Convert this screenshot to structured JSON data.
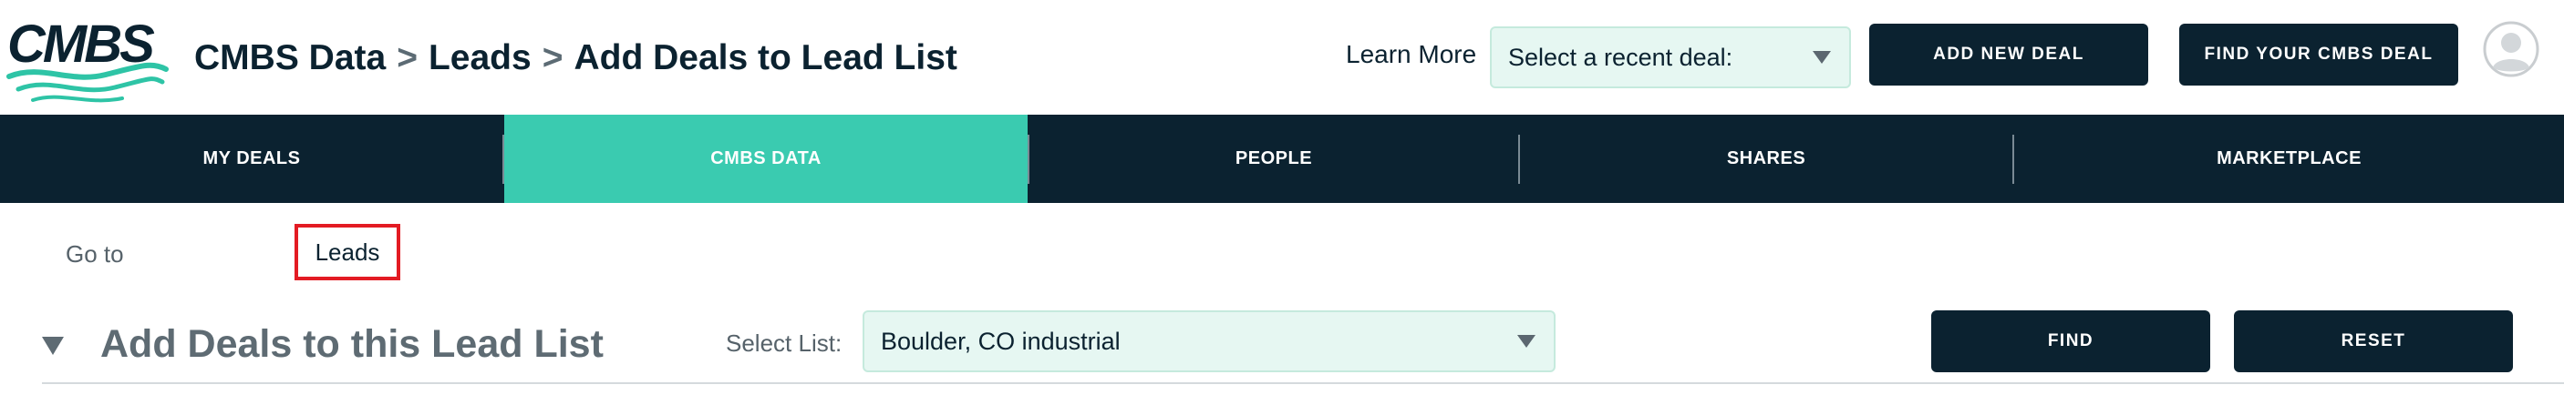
{
  "header": {
    "logo_text": "CMBS",
    "breadcrumb": [
      {
        "label": "CMBS Data"
      },
      {
        "label": "Leads"
      },
      {
        "label": "Add Deals to Lead List"
      }
    ],
    "breadcrumb_separator": ">",
    "learn_more": "Learn More",
    "recent_deal_select": {
      "value": "Select a recent deal:"
    },
    "add_new_deal": "ADD NEW DEAL",
    "find_your_deal": "FIND YOUR CMBS DEAL",
    "avatar_icon": "user-avatar-icon"
  },
  "nav": {
    "items": [
      {
        "label": "MY DEALS"
      },
      {
        "label": "CMBS DATA"
      },
      {
        "label": "PEOPLE"
      },
      {
        "label": "SHARES"
      },
      {
        "label": "MARKETPLACE"
      }
    ],
    "active_index": 1,
    "colors": {
      "bar": "#0b2230",
      "active": "#3acbb0"
    }
  },
  "content": {
    "goto_label": "Go to",
    "leads_link": "Leads",
    "section_title": "Add Deals to this Lead List",
    "select_list_label": "Select List:",
    "select_list_value": "Boulder, CO industrial",
    "find_button": "FIND",
    "reset_button": "RESET"
  },
  "colors": {
    "brand_dark": "#0b2230",
    "brand_teal": "#3acbb0",
    "select_bg": "#e6f7f2",
    "highlight_red": "#e31b23"
  }
}
